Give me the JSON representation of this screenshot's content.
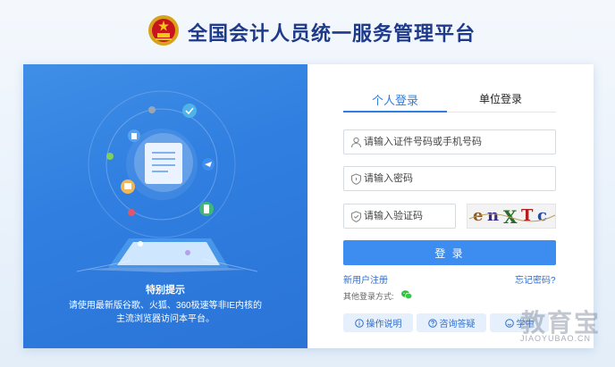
{
  "header": {
    "title": "全国会计人员统一服务管理平台",
    "emblem_icon": "national-emblem-icon"
  },
  "left_panel": {
    "tip_title": "特别提示",
    "tip_line1": "请使用最新版谷歌、火狐、360极速等非IE内核的",
    "tip_line2": "主流浏览器访问本平台。"
  },
  "login": {
    "tabs": [
      {
        "label": "个人登录",
        "active": true
      },
      {
        "label": "单位登录",
        "active": false
      }
    ],
    "id_placeholder": "请输入证件号码或手机号码",
    "password_placeholder": "请输入密码",
    "code_placeholder": "请输入验证码",
    "captcha_chars": [
      "e",
      "n",
      "X",
      "T",
      "c"
    ],
    "submit_label": "登 录",
    "register_link": "新用户注册",
    "forgot_link": "忘记密码?",
    "other_login_label": "其他登录方式:",
    "help_buttons": [
      {
        "label": "操作说明",
        "icon": "info-icon"
      },
      {
        "label": "咨询答疑",
        "icon": "question-icon"
      },
      {
        "label": "学中",
        "icon": "smile-icon"
      }
    ]
  },
  "watermark": {
    "text": "教育宝",
    "subtext": "JIAOYUBAO.CN"
  },
  "colors": {
    "primary": "#3d8cf0",
    "panel_blue": "#2f7ee0",
    "title": "#1e3a8a"
  }
}
